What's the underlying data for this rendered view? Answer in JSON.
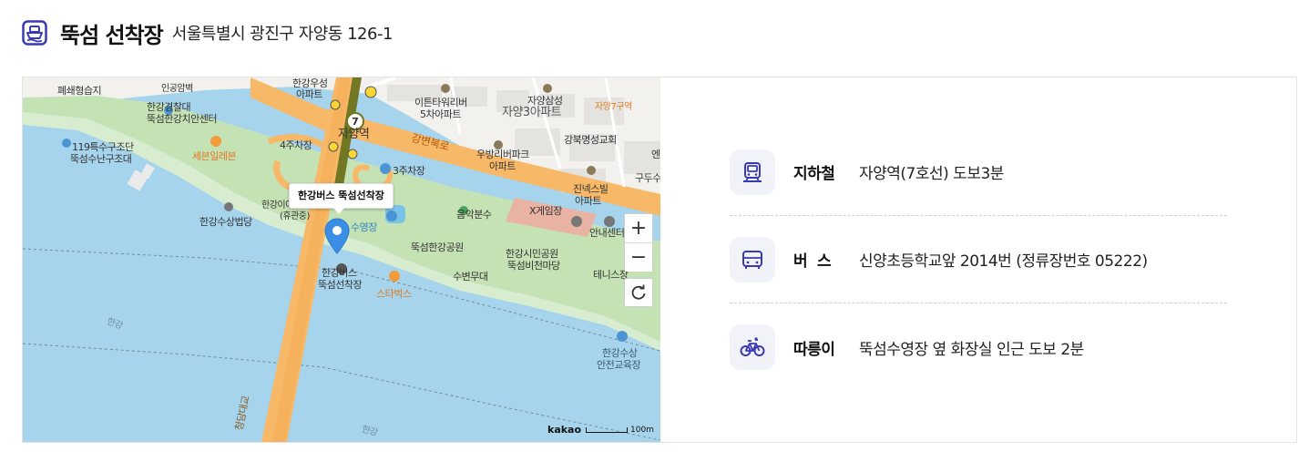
{
  "header": {
    "title": "뚝섬 선착장",
    "address": "서울특별시 광진구 자양동 126-1"
  },
  "map": {
    "callout": "한강버스 뚝섬선착장",
    "zoom_in": "+",
    "zoom_out": "−",
    "attribution": "kakao",
    "scale": "100m",
    "road_name": "강변북로",
    "labels": [
      "폐쇄형습지",
      "인공암벽",
      "한강우성",
      "아파트",
      "이튼타워리버",
      "5차아파트",
      "자양삼성",
      "자양3아파트",
      "자양7구역",
      "한강경찰대",
      "뚝섬한강치안센터",
      "4주차장",
      "자양역",
      "119특수구조단",
      "뚝섬수난구조대",
      "세븐일레븐",
      "3주차장",
      "우방리버파크",
      "아파트",
      "강북명성교회",
      "진넥스빌",
      "아파트",
      "구두수",
      "엔",
      "한강이야기전시관",
      "(휴관중)",
      "한강수상법당",
      "수영장",
      "음악분수",
      "X게임장",
      "안내센터",
      "뚝섬한강공원",
      "한강시민공원",
      "뚝섬비천마당",
      "수변무대",
      "테니스장",
      "한강버스",
      "뚝섬선착장",
      "스타벅스",
      "한강",
      "한강수상",
      "안전교육장",
      "청담대교",
      "한강"
    ]
  },
  "transport": [
    {
      "kind": "지하철",
      "icon": "subway-icon",
      "desc": "자양역(7호선) 도보3분"
    },
    {
      "kind": "버  스",
      "icon": "bus-icon",
      "desc": "신양초등학교앞 2014번 (정류장번호 05222)"
    },
    {
      "kind": "따릉이",
      "icon": "bicycle-icon",
      "desc": "뚝섬수영장 옆 화장실 인근 도보 2분"
    }
  ],
  "colors": {
    "accent": "#3a3ab5",
    "water": "#a6d4ec",
    "park": "#c5e2b5",
    "road": "#f7b868",
    "icon_bg": "#f1f3f8"
  }
}
